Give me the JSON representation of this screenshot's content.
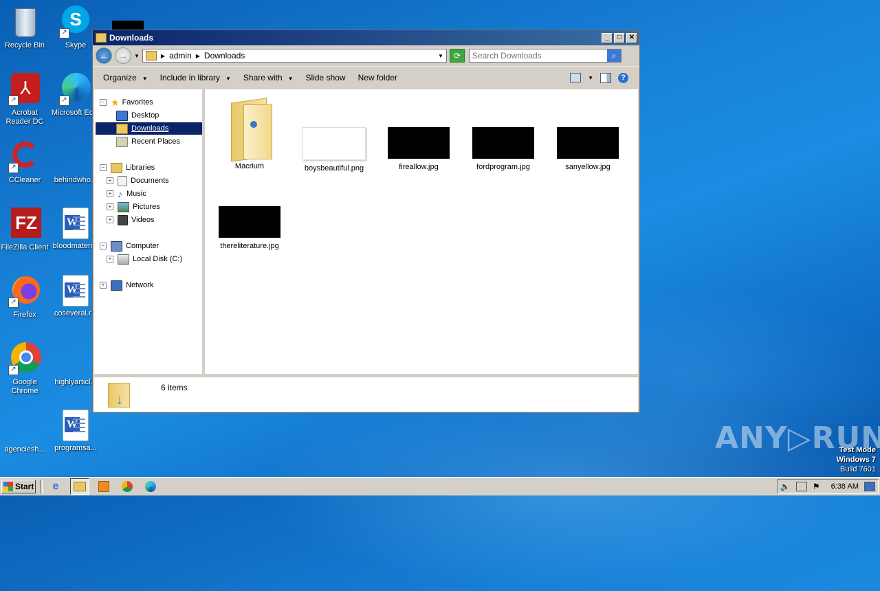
{
  "desktop": {
    "icons": [
      {
        "label": "Recycle Bin"
      },
      {
        "label": "Skype"
      },
      {
        "label": "Acrobat Reader DC"
      },
      {
        "label": "Microsoft Ed..."
      },
      {
        "label": "CCleaner"
      },
      {
        "label": "behindwho..."
      },
      {
        "label": "FileZilla Client"
      },
      {
        "label": "bloodmateri..."
      },
      {
        "label": "Firefox"
      },
      {
        "label": "coseveral.r..."
      },
      {
        "label": "Google Chrome"
      },
      {
        "label": "highlyarticl..."
      },
      {
        "label": "agenciesh..."
      },
      {
        "label": "programsa..."
      }
    ]
  },
  "window": {
    "title": "Downloads",
    "address": {
      "segments": [
        "admin",
        "Downloads"
      ]
    },
    "search_placeholder": "Search Downloads",
    "commands": [
      "Organize",
      "Include in library",
      "Share with",
      "Slide show",
      "New folder"
    ],
    "nav": {
      "favorites": "Favorites",
      "desktop": "Desktop",
      "downloads": "Downloads",
      "recent": "Recent Places",
      "libraries": "Libraries",
      "documents": "Documents",
      "music": "Music",
      "pictures": "Pictures",
      "videos": "Videos",
      "computer": "Computer",
      "localdisk": "Local Disk (C:)",
      "network": "Network"
    },
    "files": [
      {
        "name": "Macrium",
        "type": "folder"
      },
      {
        "name": "boysbeautiful.png",
        "type": "image-white"
      },
      {
        "name": "fireallow.jpg",
        "type": "image-black"
      },
      {
        "name": "fordprogram.jpg",
        "type": "image-black"
      },
      {
        "name": "sanyellow.jpg",
        "type": "image-black"
      },
      {
        "name": "thereliterature.jpg",
        "type": "image-black"
      }
    ],
    "status": "6 items"
  },
  "watermark": {
    "brand": "ANY▷RUN",
    "line1": "Test Mode",
    "line2": "Windows 7",
    "line3": "Build 7601"
  },
  "taskbar": {
    "start": "Start",
    "clock": "6:38 AM"
  },
  "colors": {
    "title_bar": "#0a246a",
    "selection": "#0a246a",
    "desktop_blue": "#1780d6"
  }
}
